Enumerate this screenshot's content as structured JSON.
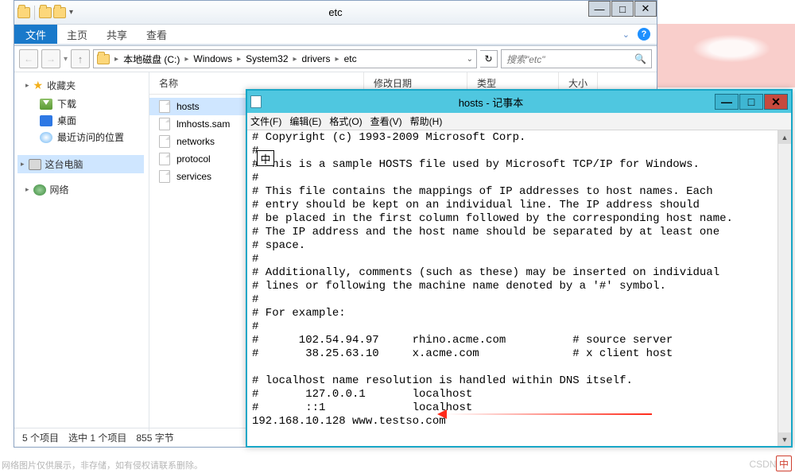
{
  "explorer": {
    "title": "etc",
    "file_tab": "文件",
    "tabs": [
      "主页",
      "共享",
      "查看"
    ],
    "breadcrumb": [
      "本地磁盘 (C:)",
      "Windows",
      "System32",
      "drivers",
      "etc"
    ],
    "search_placeholder": "搜索\"etc\"",
    "columns": {
      "name": "名称",
      "date": "修改日期",
      "type": "类型",
      "size": "大小"
    },
    "files": [
      "hosts",
      "lmhosts.sam",
      "networks",
      "protocol",
      "services"
    ],
    "selected_file": "hosts",
    "sidebar": {
      "fav": "收藏夹",
      "downloads": "下载",
      "desktop": "桌面",
      "recent": "最近访问的位置",
      "thispc": "这台电脑",
      "network": "网络"
    },
    "status": {
      "count": "5 个项目",
      "sel": "选中 1 个项目",
      "size": "855 字节"
    }
  },
  "notepad": {
    "title": "hosts - 记事本",
    "menus": {
      "file": "文件(F)",
      "edit": "编辑(E)",
      "format": "格式(O)",
      "view": "查看(V)",
      "help": "帮助(H)"
    },
    "ime": "中",
    "content": "# Copyright (c) 1993-2009 Microsoft Corp.\n#\n#  his is a sample HOSTS file used by Microsoft TCP/IP for Windows.\n#\n# This file contains the mappings of IP addresses to host names. Each\n# entry should be kept on an individual line. The IP address should\n# be placed in the first column followed by the corresponding host name.\n# The IP address and the host name should be separated by at least one\n# space.\n#\n# Additionally, comments (such as these) may be inserted on individual\n# lines or following the machine name denoted by a '#' symbol.\n#\n# For example:\n#\n#      102.54.94.97     rhino.acme.com          # source server\n#       38.25.63.10     x.acme.com              # x client host\n\n# localhost name resolution is handled within DNS itself.\n#\t127.0.0.1       localhost\n#\t::1             localhost\n192.168.10.128 www.testso.com"
  },
  "watermark": "网络图片仅供展示，非存储，如有侵权请联系删除。",
  "watermark2": "CSDN @",
  "ime_corner": "中"
}
